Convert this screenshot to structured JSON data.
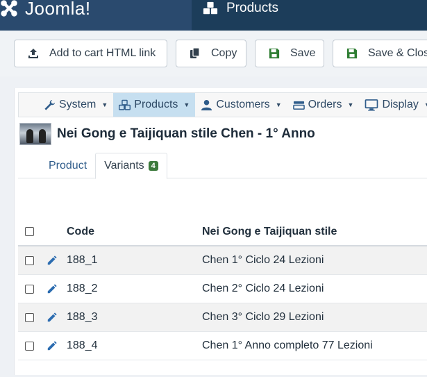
{
  "header": {
    "brand": "Joomla!",
    "page_title": "Products"
  },
  "toolbar": {
    "add_to_cart_label": "Add to cart HTML link",
    "copy_label": "Copy",
    "save_label": "Save",
    "save_close_label": "Save & Close"
  },
  "menu": {
    "items": [
      {
        "label": "System",
        "icon": "wrench-icon"
      },
      {
        "label": "Products",
        "icon": "cubes-icon"
      },
      {
        "label": "Customers",
        "icon": "user-icon"
      },
      {
        "label": "Orders",
        "icon": "list-icon"
      },
      {
        "label": "Display",
        "icon": "monitor-icon"
      }
    ]
  },
  "product": {
    "title": "Nei Gong e Taijiquan stile Chen - 1° Anno"
  },
  "tabs": {
    "product": "Product",
    "variants": "Variants",
    "variants_count": "4"
  },
  "table": {
    "headers": {
      "code": "Code",
      "name": "Nei Gong e Taijiquan stile"
    },
    "rows": [
      {
        "code": "188_1",
        "name": "Chen 1° Ciclo 24 Lezioni"
      },
      {
        "code": "188_2",
        "name": "Chen 2° Ciclo 24 Lezioni"
      },
      {
        "code": "188_3",
        "name": "Chen 3° Ciclo 29 Lezioni"
      },
      {
        "code": "188_4",
        "name": "Chen 1° Anno completo 77 Lezioni"
      }
    ]
  },
  "colors": {
    "header_bg": "#1c3d5a",
    "brand_bg": "#2a4a6e",
    "menu_active": "#c6dff0",
    "badge": "#3c7a3c",
    "edit_icon": "#2b6cb0"
  }
}
